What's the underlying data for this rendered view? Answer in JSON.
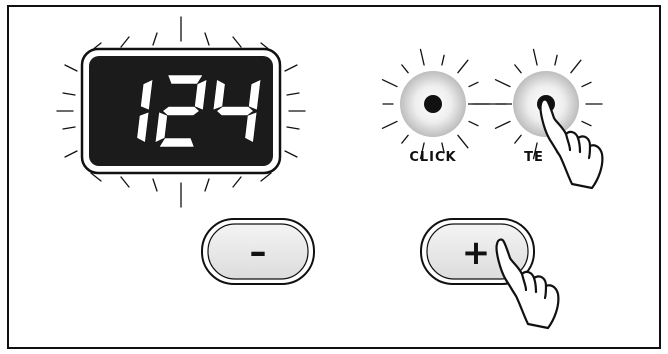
{
  "display": {
    "value": "124",
    "lit": true
  },
  "knobs": {
    "click": {
      "label": "CLICK",
      "pressed": false
    },
    "temp": {
      "label": "TEMP",
      "visible_label": "TE",
      "pressed": true
    }
  },
  "buttons": {
    "minus": {
      "label": "–",
      "pressed": false
    },
    "plus": {
      "label": "+",
      "pressed": true
    }
  },
  "colors": {
    "frame": "#111111",
    "display_bg": "#1b1b1b",
    "segment": "#ffffff",
    "button_fill": "#e9e9e9"
  },
  "icons": [
    "pointing-hand-icon",
    "pointing-hand-icon"
  ]
}
